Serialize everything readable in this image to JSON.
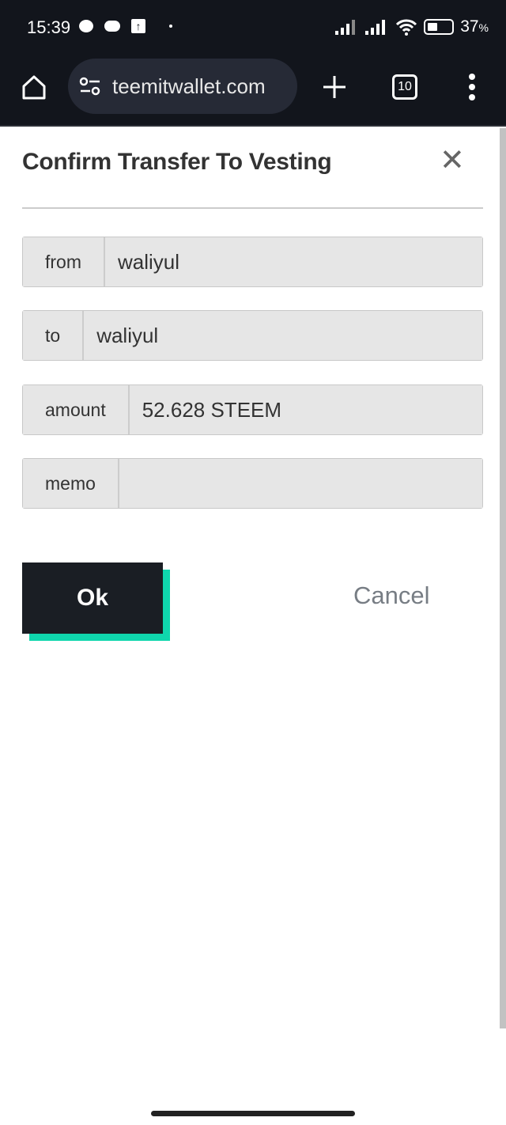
{
  "status_bar": {
    "time": "15:39",
    "battery": "37",
    "battery_unit": "%",
    "notification_icons": [
      "chat-bubble-icon",
      "axis-message-icon",
      "upload-icon"
    ]
  },
  "browser": {
    "url": "teemitwallet.com",
    "tab_count": "10"
  },
  "dialog": {
    "title": "Confirm Transfer To Vesting",
    "fields": [
      {
        "label": "from",
        "value": "waliyul"
      },
      {
        "label": "to",
        "value": "waliyul"
      },
      {
        "label": "amount",
        "value": "52.628 STEEM"
      },
      {
        "label": "memo",
        "value": ""
      }
    ],
    "ok_label": "Ok",
    "cancel_label": "Cancel",
    "accent_color": "#0fd6ad"
  }
}
